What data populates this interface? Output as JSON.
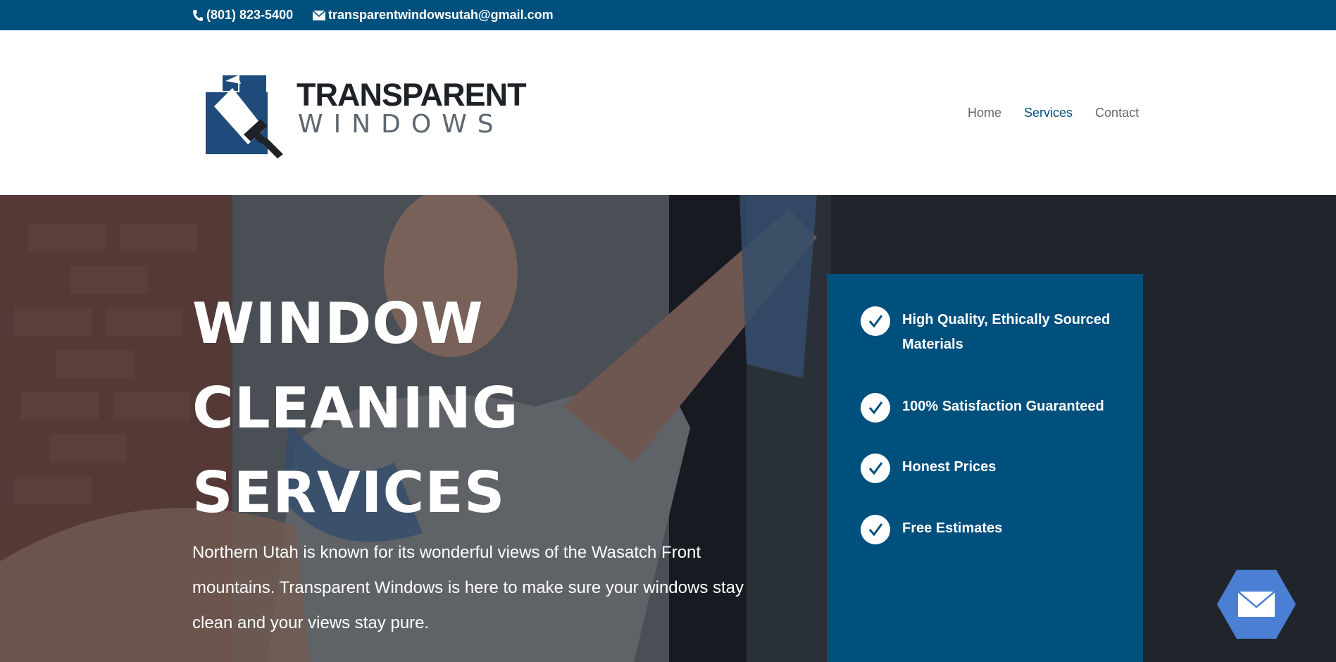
{
  "topbar": {
    "phone": "(801) 823-5400",
    "email": "transparentwindowsutah@gmail.com",
    "phone_icon": "phone-icon",
    "email_icon": "envelope-icon"
  },
  "logo": {
    "line1": "TRANSPARENT",
    "line2": "WINDOWS"
  },
  "nav": {
    "items": [
      {
        "label": "Home",
        "active": false
      },
      {
        "label": "Services",
        "active": true
      },
      {
        "label": "Contact",
        "active": false
      }
    ]
  },
  "hero": {
    "title_lines": [
      "WINDOW",
      "CLEANING",
      "SERVICES"
    ],
    "description": "Northern Utah is known for its wonderful views of the Wasatch Front mountains. Transparent Windows is here to make sure your windows stay clean and your views stay pure."
  },
  "features": {
    "items": [
      {
        "label": "High Quality, Ethically Sourced Materials"
      },
      {
        "label": "100% Satisfaction Guaranteed"
      },
      {
        "label": "Honest Prices"
      },
      {
        "label": "Free Estimates"
      }
    ]
  },
  "floating_button": {
    "icon": "envelope-icon",
    "color": "#4a7fd4"
  },
  "colors": {
    "brand_blue": "#00507e",
    "nav_text": "#666666"
  }
}
